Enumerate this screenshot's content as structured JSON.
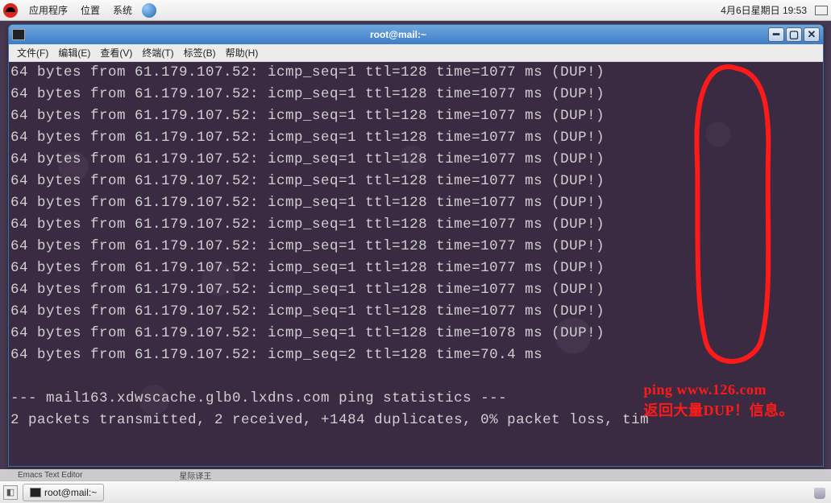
{
  "top_panel": {
    "menu_apps": "应用程序",
    "menu_places": "位置",
    "menu_system": "系统",
    "clock": "4月6日星期日 19:53"
  },
  "window": {
    "title": "root@mail:~"
  },
  "menubar": {
    "file": "文件(F)",
    "edit": "编辑(E)",
    "view": "查看(V)",
    "terminal": "终端(T)",
    "tabs": "标签(B)",
    "help": "帮助(H)"
  },
  "terminal": {
    "ping_lines": [
      "64 bytes from 61.179.107.52: icmp_seq=1 ttl=128 time=1077 ms (DUP!)",
      "64 bytes from 61.179.107.52: icmp_seq=1 ttl=128 time=1077 ms (DUP!)",
      "64 bytes from 61.179.107.52: icmp_seq=1 ttl=128 time=1077 ms (DUP!)",
      "64 bytes from 61.179.107.52: icmp_seq=1 ttl=128 time=1077 ms (DUP!)",
      "64 bytes from 61.179.107.52: icmp_seq=1 ttl=128 time=1077 ms (DUP!)",
      "64 bytes from 61.179.107.52: icmp_seq=1 ttl=128 time=1077 ms (DUP!)",
      "64 bytes from 61.179.107.52: icmp_seq=1 ttl=128 time=1077 ms (DUP!)",
      "64 bytes from 61.179.107.52: icmp_seq=1 ttl=128 time=1077 ms (DUP!)",
      "64 bytes from 61.179.107.52: icmp_seq=1 ttl=128 time=1077 ms (DUP!)",
      "64 bytes from 61.179.107.52: icmp_seq=1 ttl=128 time=1077 ms (DUP!)",
      "64 bytes from 61.179.107.52: icmp_seq=1 ttl=128 time=1077 ms (DUP!)",
      "64 bytes from 61.179.107.52: icmp_seq=1 ttl=128 time=1077 ms (DUP!)",
      "64 bytes from 61.179.107.52: icmp_seq=1 ttl=128 time=1078 ms (DUP!)",
      "64 bytes from 61.179.107.52: icmp_seq=2 ttl=128 time=70.4 ms"
    ],
    "stats_sep": "--- mail163.xdwscache.glb0.lxdns.com ping statistics ---",
    "stats_line": "2 packets transmitted, 2 received, +1484 duplicates, 0% packet loss, tim"
  },
  "annotation": {
    "line1": "ping www.126.com",
    "line2": "返回大量DUP！信息。"
  },
  "bottom_panel": {
    "task1": "Emacs Text Editor",
    "task2": "星际译王",
    "taskbtn": "root@mail:~"
  }
}
